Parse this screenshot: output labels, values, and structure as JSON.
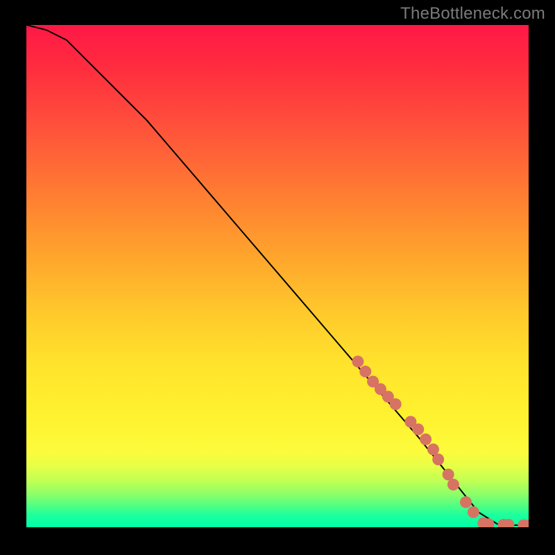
{
  "watermark": "TheBottleneck.com",
  "colors": {
    "line": "#000000",
    "marker": "#d77362",
    "background_top": "#ff1846",
    "background_bottom": "#00ffa8",
    "page": "#000000"
  },
  "chart_data": {
    "type": "line",
    "title": "",
    "xlabel": "",
    "ylabel": "",
    "xlim": [
      0,
      100
    ],
    "ylim": [
      0,
      100
    ],
    "grid": false,
    "legend": false,
    "series": [
      {
        "name": "curve",
        "x": [
          0,
          4,
          8,
          12,
          18,
          24,
          30,
          36,
          42,
          48,
          54,
          60,
          66,
          72,
          78,
          82,
          86,
          90,
          94,
          98,
          100
        ],
        "y": [
          100,
          99,
          97,
          93,
          87,
          81,
          74,
          67,
          60,
          53,
          46,
          39,
          32,
          25,
          18,
          13,
          8,
          3,
          0.5,
          0.4,
          0.4
        ]
      }
    ],
    "markers": {
      "name": "highlighted-points",
      "color": "#d77362",
      "points": [
        {
          "x": 66,
          "y": 33
        },
        {
          "x": 67.5,
          "y": 31
        },
        {
          "x": 69,
          "y": 29
        },
        {
          "x": 70.5,
          "y": 27.5
        },
        {
          "x": 72,
          "y": 26
        },
        {
          "x": 73.5,
          "y": 24.5
        },
        {
          "x": 76.5,
          "y": 21
        },
        {
          "x": 78,
          "y": 19.5
        },
        {
          "x": 79.5,
          "y": 17.5
        },
        {
          "x": 81,
          "y": 15.5
        },
        {
          "x": 82,
          "y": 13.5
        },
        {
          "x": 84,
          "y": 10.5
        },
        {
          "x": 85,
          "y": 8.5
        },
        {
          "x": 87.5,
          "y": 5
        },
        {
          "x": 89,
          "y": 3
        },
        {
          "x": 91,
          "y": 0.8
        },
        {
          "x": 92,
          "y": 0.6
        },
        {
          "x": 95,
          "y": 0.5
        },
        {
          "x": 96,
          "y": 0.5
        },
        {
          "x": 99,
          "y": 0.4
        },
        {
          "x": 100,
          "y": 0.4
        }
      ]
    }
  }
}
